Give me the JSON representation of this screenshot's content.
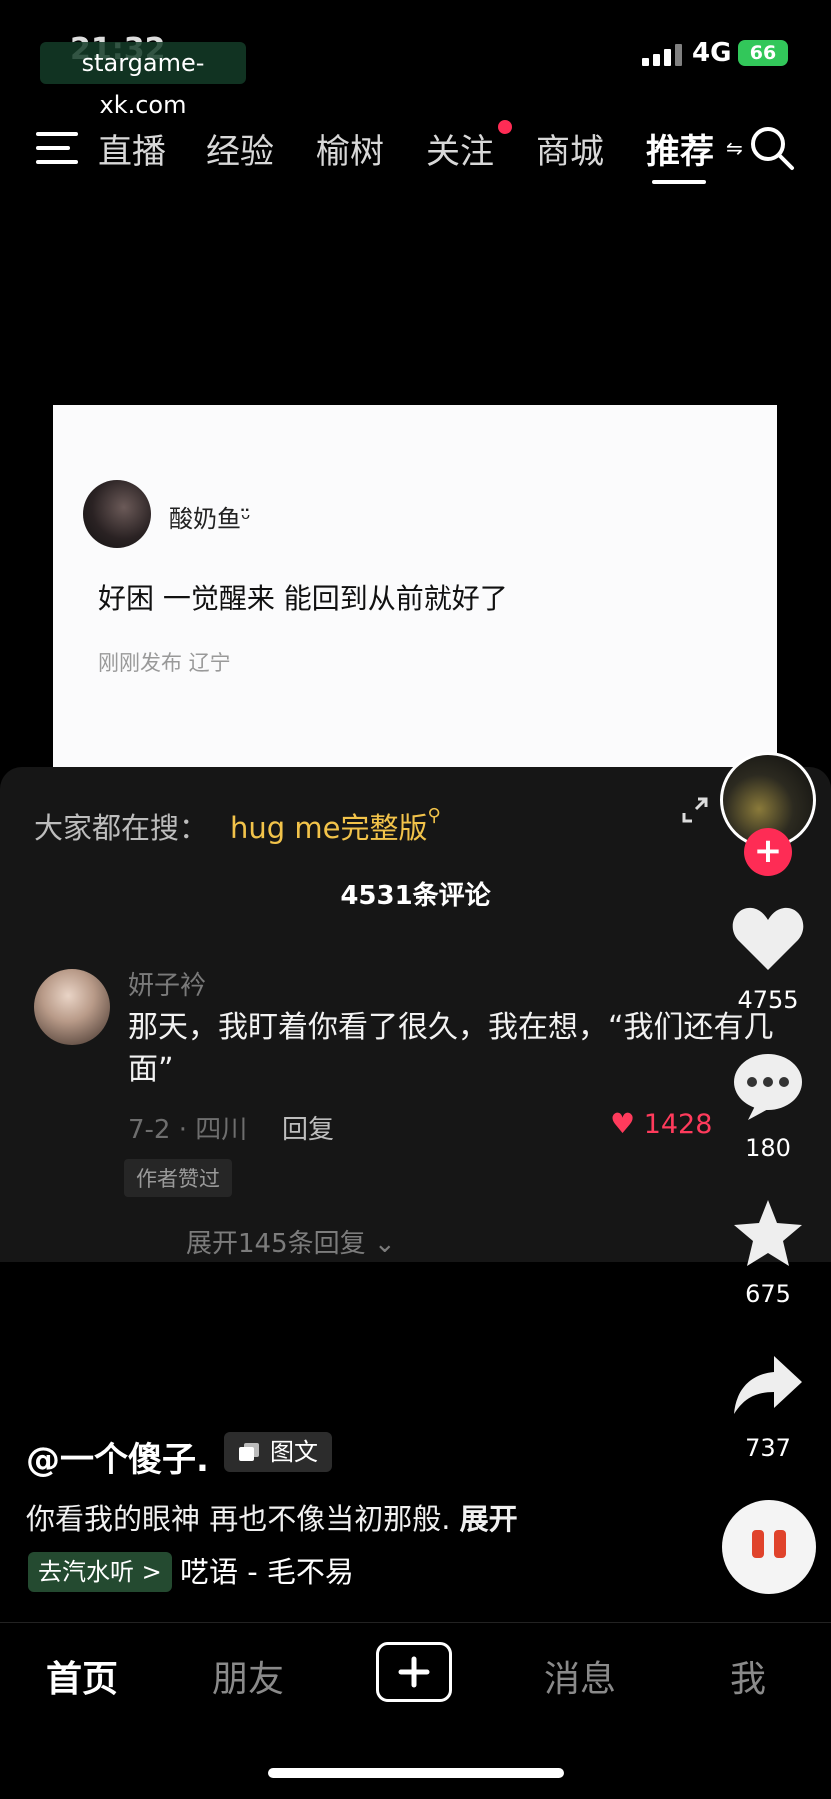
{
  "status_bar": {
    "time": "21:32",
    "network": "4G",
    "battery": "66",
    "watermark": "stargame-xk.com"
  },
  "top_nav": {
    "tabs": [
      {
        "label": "直播"
      },
      {
        "label": "经验"
      },
      {
        "label": "榆树"
      },
      {
        "label": "关注",
        "has_dot": true
      },
      {
        "label": "商城"
      },
      {
        "label": "推荐",
        "active": true
      }
    ],
    "icons": {
      "menu": "menu-icon",
      "search": "search-icon"
    }
  },
  "post_card": {
    "username": "酸奶鱼ᵕ̈",
    "text": "好困 一觉醒来 能回到从前就好了",
    "meta": "刚刚发布 辽宁"
  },
  "comments": {
    "suggest_label": "大家都在搜：",
    "suggest_term": "hug me完整版",
    "count_label": "4531条评论",
    "top_comment": {
      "user": "妍子衿",
      "text": "那天，我盯着你看了很久，我在想，“我们还有几面”",
      "date_location": "7-2 · 四川",
      "reply_label": "回复",
      "likes": "1428",
      "author_liked": "作者赞过",
      "more_replies": "展开145条回复"
    }
  },
  "right_rail": {
    "likes": "4755",
    "comments": "180",
    "favorites": "675",
    "shares": "737"
  },
  "caption": {
    "author": "@一个傻子.",
    "type_badge": "图文",
    "description": "你看我的眼神 再也不像当初那般.",
    "expand_label": "展开",
    "music_tag": "去汽水听 >",
    "song": "呓语 - 毛不易"
  },
  "bottom_nav": {
    "home": "首页",
    "friends": "朋友",
    "messages": "消息",
    "me": "我"
  },
  "colors": {
    "accent": "#fe2c55",
    "highlight": "#f2c34a",
    "battery": "#32c75a"
  }
}
